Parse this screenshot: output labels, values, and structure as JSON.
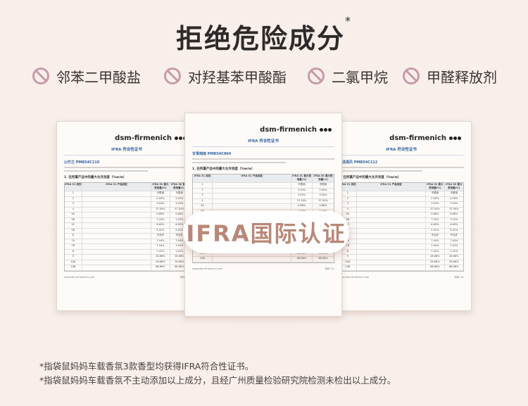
{
  "title": {
    "text": "拒绝危险成分",
    "mark": "*"
  },
  "bans": [
    {
      "label": "邻苯二甲酸盐",
      "icon": "prohibited-icon"
    },
    {
      "label": "对羟基苯甲酸酯",
      "icon": "prohibited-icon"
    },
    {
      "label": "二氯甲烷",
      "icon": "prohibited-icon"
    },
    {
      "label": "甲醛释放剂",
      "icon": "prohibited-icon"
    }
  ],
  "certificates": {
    "brand": "dsm-firmenich",
    "doc_title": "IFRA 符合性证书",
    "left_code": "山竹兰 PMB54C110",
    "center_code": "甘青雨雨 PMB54C004",
    "right_code": "海滨清风 PMB54C112",
    "section": "1. 在所属产品中的最大允许浓度（%w/w）",
    "table_header": [
      "IFRA 51 类别",
      "IFRA 51 产品类型",
      "IFRA 51 最大限用量(%)",
      "IFRA 50 最大限用量(%)"
    ],
    "table_rows": [
      [
        "1",
        "",
        "不限用",
        "不限用"
      ],
      [
        "2",
        "",
        "2.00%",
        "2.00%"
      ],
      [
        "3",
        "",
        "3.54%",
        "3.54%"
      ],
      [
        "4",
        "",
        "37.50%",
        "37.50%"
      ],
      [
        "5A",
        "",
        "0.66%",
        "0.66%"
      ],
      [
        "5B",
        "",
        "7.25%",
        "7.25%"
      ],
      [
        "5C",
        "",
        "6.69%",
        "6.69%"
      ],
      [
        "5D",
        "",
        "2.41%",
        "2.41%"
      ],
      [
        "6",
        "",
        "不允许",
        "不允许"
      ],
      [
        "7A",
        "",
        "7.44%",
        "7.44%"
      ],
      [
        "7B",
        "",
        "7.44%",
        "7.44%"
      ],
      [
        "8",
        "",
        "1.42%",
        "1.42%"
      ],
      [
        "9",
        "",
        "26.66%",
        "26.66%"
      ],
      [
        "10A",
        "",
        "26.66%",
        "26.66%"
      ],
      [
        "10B",
        "",
        "68.66%",
        "68.66%"
      ]
    ],
    "footer_url": "www.dsm-firmenich.com",
    "footer_page": "页码 1/1"
  },
  "badge": "IFRA国际认证",
  "notes": [
    "*指袋鼠妈妈车载香氛3款香型均获得IFRA符合性证书。",
    "*指袋鼠妈妈车载香氛不主动添加以上成分，且经广州质量检验研究院检测未检出以上成分。"
  ],
  "colors": {
    "background": "#f8efeb",
    "ban_icon": "#c99aab",
    "badge_text": "#b88878",
    "title_text": "#2e2a29"
  }
}
